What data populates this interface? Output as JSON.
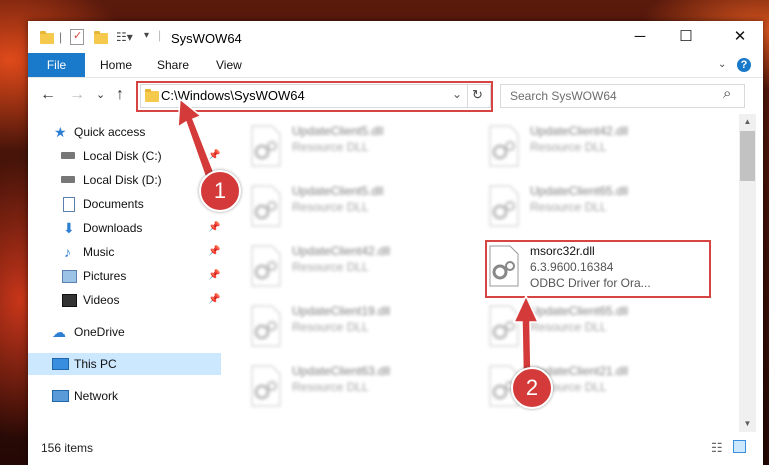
{
  "window": {
    "title": "SysWOW64",
    "controls": {
      "minimize": "─",
      "maximize": "☐",
      "close": "✕"
    }
  },
  "ribbon": {
    "tabs": [
      "File",
      "Home",
      "Share",
      "View"
    ],
    "help": "?"
  },
  "navbar": {
    "back": "←",
    "forward": "→",
    "recent": "⌄",
    "up": "↑",
    "address": "C:\\Windows\\SysWOW64",
    "address_dropdown": "⌄",
    "refresh": "↻",
    "search_placeholder": "Search SysWOW64",
    "search_icon": "⌕"
  },
  "sidebar": {
    "items": [
      {
        "label": "Quick access",
        "icon": "star-icon",
        "pinned": false
      },
      {
        "label": "Local Disk (C:)",
        "icon": "drive-icon",
        "pinned": true
      },
      {
        "label": "Local Disk (D:)",
        "icon": "drive-icon",
        "pinned": true
      },
      {
        "label": "Documents",
        "icon": "documents-icon",
        "pinned": true
      },
      {
        "label": "Downloads",
        "icon": "downloads-icon",
        "pinned": true
      },
      {
        "label": "Music",
        "icon": "music-icon",
        "pinned": true
      },
      {
        "label": "Pictures",
        "icon": "pictures-icon",
        "pinned": true
      },
      {
        "label": "Videos",
        "icon": "videos-icon",
        "pinned": true
      },
      {
        "label": "OneDrive",
        "icon": "cloud-icon",
        "pinned": false
      },
      {
        "label": "This PC",
        "icon": "computer-icon",
        "pinned": false
      },
      {
        "label": "Network",
        "icon": "network-icon",
        "pinned": false
      }
    ]
  },
  "files": {
    "col1": [
      {
        "name": "UpdateClient5.dll",
        "desc": "Resource DLL"
      },
      {
        "name": "UpdateClient5.dll",
        "desc": "Resource DLL"
      },
      {
        "name": "UpdateClient42.dll",
        "desc": "Resource DLL"
      },
      {
        "name": "UpdateClient19.dll",
        "desc": "Resource DLL"
      },
      {
        "name": "UpdateClient63.dll",
        "desc": "Resource DLL"
      }
    ],
    "col2_top": [
      {
        "name": "UpdateClient42.dll",
        "desc": "Resource DLL"
      },
      {
        "name": "UpdateClient65.dll",
        "desc": "Resource DLL"
      }
    ],
    "highlighted": {
      "name": "msorc32r.dll",
      "version": "6.3.9600.16384",
      "desc": "ODBC Driver for Ora..."
    },
    "col2_bottom": [
      {
        "name": "UpdateClient65.dll",
        "desc": "Resource DLL"
      },
      {
        "name": "UpdateClient21.dll",
        "desc": "Resource DLL"
      }
    ]
  },
  "status": {
    "item_count": "156 items"
  },
  "markers": {
    "step1": "1",
    "step2": "2"
  },
  "colors": {
    "accent": "#1979ca",
    "highlight": "#d64541",
    "selected": "#cce8ff"
  }
}
